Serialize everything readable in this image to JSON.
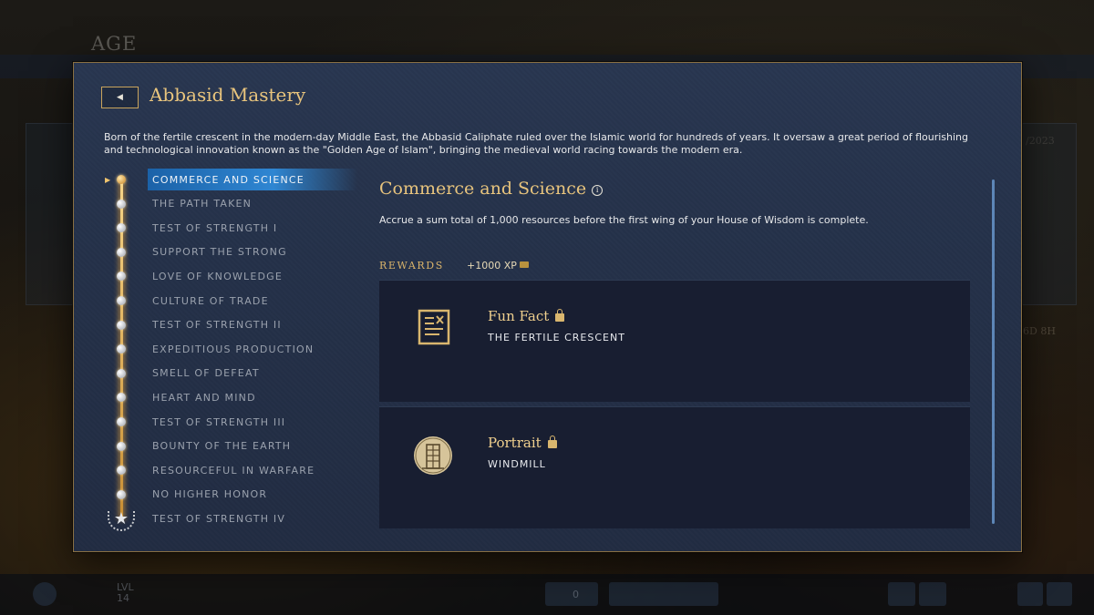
{
  "background": {
    "title": "AGE",
    "date_fragment": "/2023",
    "time_fragment": "6D 8H",
    "level_label": "LVL",
    "level_value": "14",
    "counter": "0"
  },
  "modal": {
    "back_icon": "chevron-left-icon",
    "title": "Abbasid Mastery",
    "description": "Born of the fertile crescent in the modern-day Middle East, the Abbasid Caliphate ruled over the Islamic world for hundreds of years. It oversaw a great period of flourishing and technological innovation known as the \"Golden Age of Islam\", bringing the medieval world racing towards the modern era."
  },
  "challenges": [
    {
      "label": "COMMERCE AND SCIENCE",
      "active": true
    },
    {
      "label": "THE PATH TAKEN"
    },
    {
      "label": "TEST OF STRENGTH I"
    },
    {
      "label": "SUPPORT THE STRONG"
    },
    {
      "label": "LOVE OF KNOWLEDGE"
    },
    {
      "label": "CULTURE OF TRADE"
    },
    {
      "label": "TEST OF STRENGTH II"
    },
    {
      "label": "EXPEDITIOUS PRODUCTION"
    },
    {
      "label": "SMELL OF DEFEAT"
    },
    {
      "label": "HEART AND MIND"
    },
    {
      "label": "TEST OF STRENGTH III"
    },
    {
      "label": "BOUNTY OF THE EARTH"
    },
    {
      "label": "RESOURCEFUL IN WARFARE"
    },
    {
      "label": "NO HIGHER HONOR"
    },
    {
      "label": "TEST OF STRENGTH IV",
      "final": true
    }
  ],
  "detail": {
    "title": "Commerce and Science",
    "info_icon": "info-icon",
    "description": "Accrue a sum total of 1,000 resources before the first wing of your House of Wisdom is complete.",
    "rewards_label": "REWARDS",
    "xp": "+1000 XP",
    "rewards": [
      {
        "name": "Fun Fact",
        "subtitle": "THE FERTILE CRESCENT",
        "icon": "document-icon",
        "locked": true
      },
      {
        "name": "Portrait",
        "subtitle": "WINDMILL",
        "icon": "windmill-portrait-icon",
        "locked": true
      }
    ]
  },
  "colors": {
    "accent_gold": "#e8c47d",
    "highlight_blue": "#2f86d2",
    "panel_bg": "#243149",
    "card_bg": "#181e31"
  }
}
